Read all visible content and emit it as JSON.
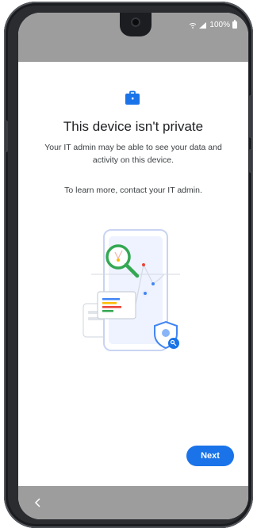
{
  "status_bar": {
    "battery_percent": "100%",
    "icons": [
      "wifi-calling-icon",
      "signal-icon",
      "battery-icon"
    ]
  },
  "header": {
    "icon": "briefcase-icon",
    "title": "This device isn't private"
  },
  "main": {
    "description": "Your IT admin may be able to see your data and activity on this device.",
    "learn_more": "To learn more, contact your IT admin.",
    "illustration": "device-privacy-illustration"
  },
  "actions": {
    "next_label": "Next"
  },
  "nav_bar": {
    "icons": [
      "back-icon"
    ]
  },
  "colors": {
    "accent": "#1a73e8",
    "status_bar": "#9d9d9d",
    "magnifier": "#34a853"
  }
}
